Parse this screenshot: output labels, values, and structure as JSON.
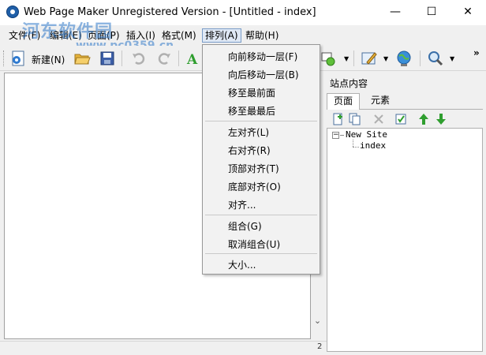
{
  "window": {
    "title": "Web Page Maker Unregistered Version - [Untitled - index]",
    "minimize_glyph": "—",
    "maximize_glyph": "☐",
    "close_glyph": "✕"
  },
  "watermark": {
    "text": "河东软件园",
    "url": "www.pc0359.cn"
  },
  "menubar": {
    "items": [
      {
        "label": "文件(F)"
      },
      {
        "label": "编辑(E)"
      },
      {
        "label": "页面(P)"
      },
      {
        "label": "插入(I)"
      },
      {
        "label": "格式(M)"
      },
      {
        "label": "排列(A)",
        "active": true
      },
      {
        "label": "帮助(H)"
      }
    ]
  },
  "toolbar": {
    "new_label": "新建(N)",
    "overflow_glyph": "»"
  },
  "dropdown": {
    "groups": [
      [
        "向前移动一层(F)",
        "向后移动一层(B)",
        "移至最前面",
        "移至最最后"
      ],
      [
        "左对齐(L)",
        "右对齐(R)",
        "顶部对齐(T)",
        "底部对齐(O)",
        "对齐..."
      ],
      [
        "组合(G)",
        "取消组合(U)"
      ],
      [
        "大小..."
      ]
    ]
  },
  "panel": {
    "title": "站点内容",
    "tabs": [
      {
        "label": "页面",
        "active": true
      },
      {
        "label": "元素",
        "active": false
      }
    ],
    "tree": {
      "root": "New Site",
      "children": [
        "index"
      ]
    }
  },
  "statusbar": {
    "cell_text": "2"
  },
  "colors": {
    "accent": "#1f5fa8",
    "menu_highlight": "#dfe8f5",
    "green_arrow": "#2f9e2f",
    "folder": "#e8b43a"
  },
  "icons": [
    "app-icon",
    "new-page-icon",
    "open-folder-icon",
    "save-icon",
    "undo-icon",
    "redo-icon",
    "text-icon",
    "shape-icon",
    "pen-icon",
    "globe-icon",
    "magnifier-icon",
    "add-page-icon",
    "copy-page-icon",
    "delete-icon",
    "properties-icon",
    "move-up-icon",
    "move-down-icon"
  ]
}
